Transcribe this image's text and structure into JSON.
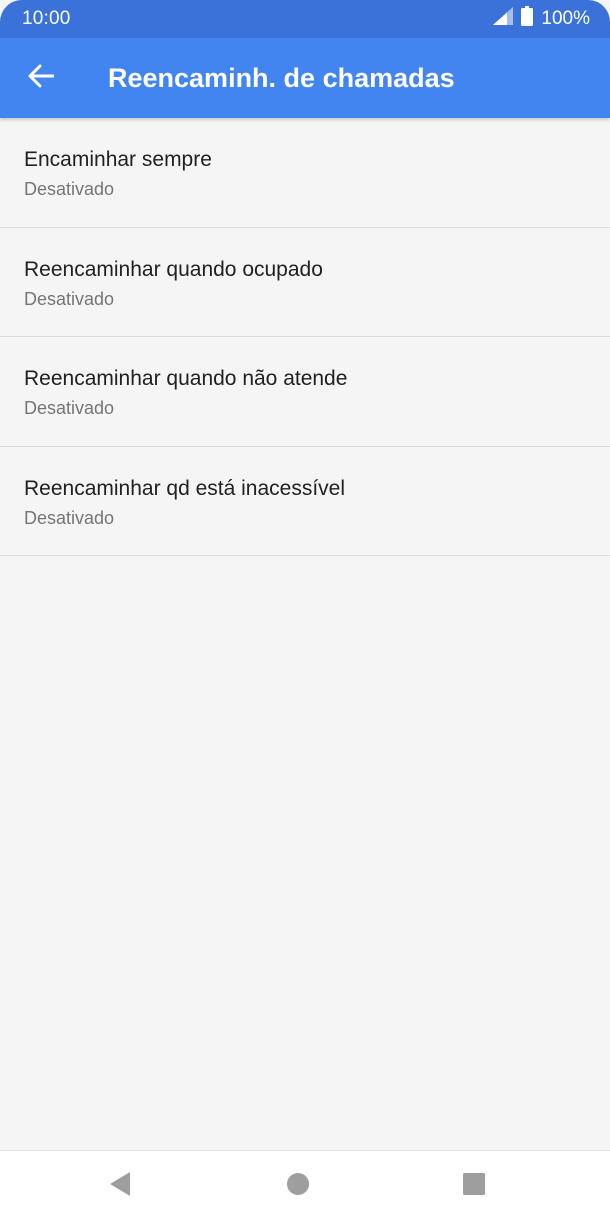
{
  "status_bar": {
    "time": "10:00",
    "battery": "100%",
    "icons": [
      "signal-icon",
      "battery-icon"
    ]
  },
  "app_bar": {
    "title": "Reencaminh. de chamadas",
    "back_icon": "arrow-left-icon"
  },
  "settings": [
    {
      "title": "Encaminhar sempre",
      "status": "Desativado"
    },
    {
      "title": "Reencaminhar quando ocupado",
      "status": "Desativado"
    },
    {
      "title": "Reencaminhar quando não atende",
      "status": "Desativado"
    },
    {
      "title": "Reencaminhar qd está inacessível",
      "status": "Desativado"
    }
  ],
  "nav_bar": {
    "icons": [
      "back-triangle-icon",
      "home-circle-icon",
      "recents-square-icon"
    ]
  },
  "colors": {
    "status_bar": "#3b72d9",
    "app_bar": "#4285f0",
    "background": "#f5f5f5"
  }
}
